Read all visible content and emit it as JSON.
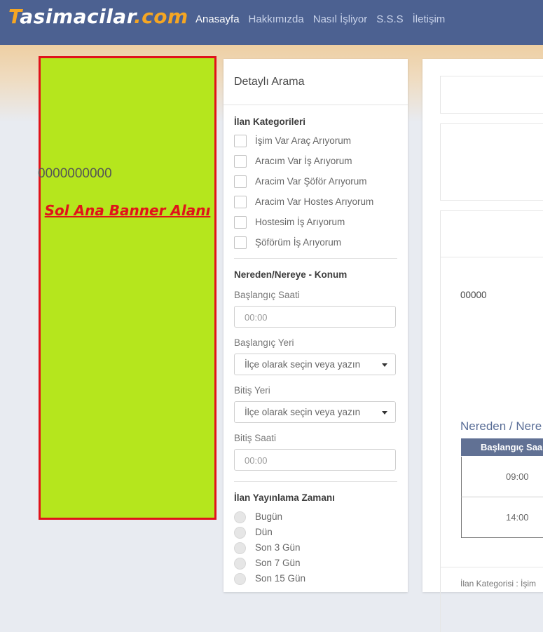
{
  "header": {
    "logo": {
      "part1": "T",
      "part2": "asimacilar",
      "part3": ".com"
    },
    "nav": [
      {
        "label": "Anasayfa"
      },
      {
        "label": "Hakkımızda"
      },
      {
        "label": "Nasıl İşliyor"
      },
      {
        "label": "S.S.S"
      },
      {
        "label": "İletişim"
      }
    ]
  },
  "banner": {
    "text": "Sol Ana Banner Alanı"
  },
  "search_panel": {
    "title": "Detaylı Arama",
    "categories_title": "İlan Kategorileri",
    "categories": [
      {
        "label": "İşim Var Araç Arıyorum"
      },
      {
        "label": "Aracım Var İş Arıyorum"
      },
      {
        "label": "Aracim Var Şöför Arıyorum"
      },
      {
        "label": "Aracim Var Hostes Arıyorum"
      },
      {
        "label": "Hostesim İş Arıyorum"
      },
      {
        "label": "Şöförüm İş Arıyorum"
      }
    ],
    "location_title": "Nereden/Nereye - Konum",
    "start_time": {
      "label": "Başlangıç Saati",
      "placeholder": "00:00"
    },
    "start_place": {
      "label": "Başlangıç Yeri",
      "value": "İlçe olarak seçin veya yazın"
    },
    "end_place": {
      "label": "Bitiş Yeri",
      "value": "İlçe olarak seçin veya yazın"
    },
    "end_time": {
      "label": "Bitiş Saati",
      "placeholder": "00:00"
    },
    "publish_title": "İlan Yayınlama Zamanı",
    "publish_options": [
      {
        "label": "Bugün"
      },
      {
        "label": "Dün"
      },
      {
        "label": "Son 3 Gün"
      },
      {
        "label": "Son 7 Gün"
      },
      {
        "label": "Son 15 Gün"
      }
    ]
  },
  "listing": {
    "title": "0000000000",
    "text": "00000",
    "route_title": "Nereden / Nere",
    "table_header": "Başlangıç Saa",
    "rows": [
      {
        "time": "09:00"
      },
      {
        "time": "14:00"
      }
    ],
    "footer": "İlan Kategorisi : İşim"
  },
  "colors": {
    "topbar": "#4c6191",
    "accent": "#f5a623",
    "banner_bg": "#b5e61d",
    "banner_border": "#e0131b"
  }
}
